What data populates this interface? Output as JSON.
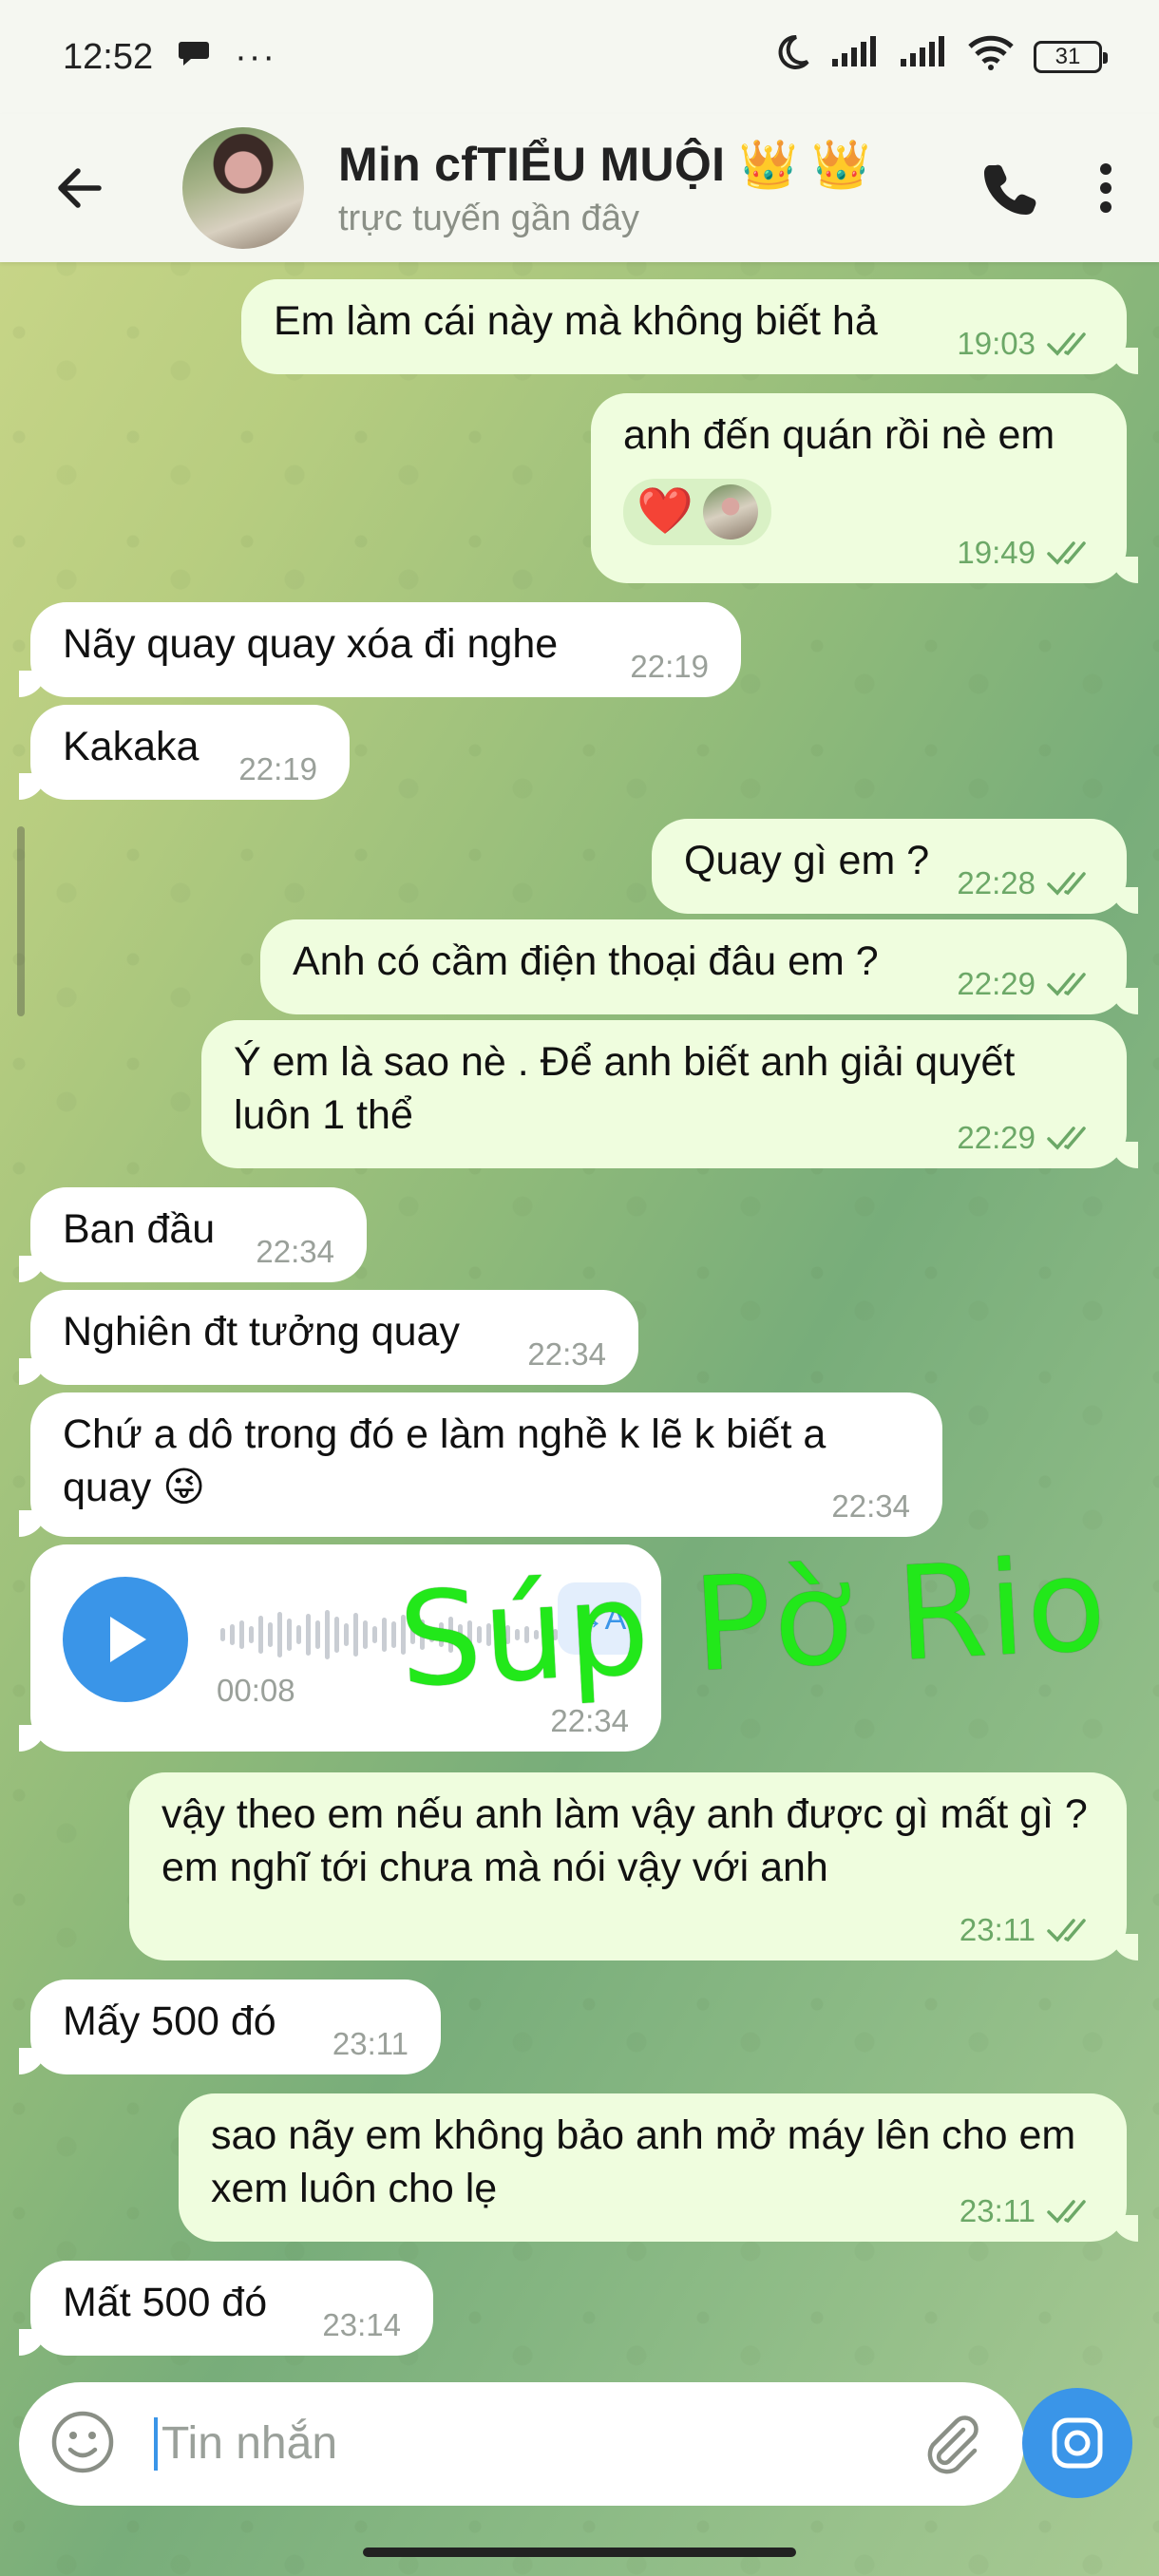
{
  "status_bar": {
    "time": "12:52",
    "chat_icon": "message-icon",
    "more_icon": "ellipsis",
    "battery": "31"
  },
  "header": {
    "name": "Min cfTIỂU MUỘI 👑 👑",
    "status": "trực tuyến gần đây"
  },
  "messages": [
    {
      "dir": "out",
      "text": "Em làm cái này mà không biết hả",
      "time": "19:03"
    },
    {
      "dir": "out",
      "text": "anh đến quán rồi nè em",
      "time": "19:49",
      "reaction": "❤️"
    },
    {
      "dir": "in",
      "text": "Nãy quay quay xóa đi nghe",
      "time": "22:19"
    },
    {
      "dir": "in",
      "text": "Kakaka",
      "time": "22:19"
    },
    {
      "dir": "out",
      "text": "Quay gì em ?",
      "time": "22:28"
    },
    {
      "dir": "out",
      "text": "Anh có cầm điện thoại đâu em ?",
      "time": "22:29"
    },
    {
      "dir": "out",
      "text": "Ý em là sao nè . Để anh biết anh giải quyết luôn 1 thể",
      "time": "22:29"
    },
    {
      "dir": "in",
      "text": "Ban đầu",
      "time": "22:34"
    },
    {
      "dir": "in",
      "text": "Nghiên đt tưởng quay",
      "time": "22:34"
    },
    {
      "dir": "in",
      "text": "Chứ a dô trong đó e làm nghề k lẽ k biết a quay 😜",
      "time": "22:34"
    },
    {
      "dir": "in",
      "type": "voice",
      "duration": "00:08",
      "time": "22:34",
      "transcribe_label": "→A"
    },
    {
      "dir": "out",
      "text": "vậy theo em nếu anh làm vậy anh được gì mất gì ? em nghĩ tới chưa mà nói vậy với anh",
      "time": "23:11"
    },
    {
      "dir": "in",
      "text": "Mấy 500 đó",
      "time": "23:11"
    },
    {
      "dir": "out",
      "text": "sao nãy em không bảo anh mở máy lên cho em xem luôn cho lẹ",
      "time": "23:11"
    },
    {
      "dir": "in",
      "text": "Mất 500 đó",
      "time": "23:14"
    }
  ],
  "watermark": "Súp Pờ Rio",
  "composer": {
    "placeholder": "Tin nhắn"
  },
  "colors": {
    "accent": "#3a95e8",
    "outgoing_bubble": "#effdde",
    "incoming_bubble": "#ffffff",
    "watermark": "#22e81a"
  }
}
